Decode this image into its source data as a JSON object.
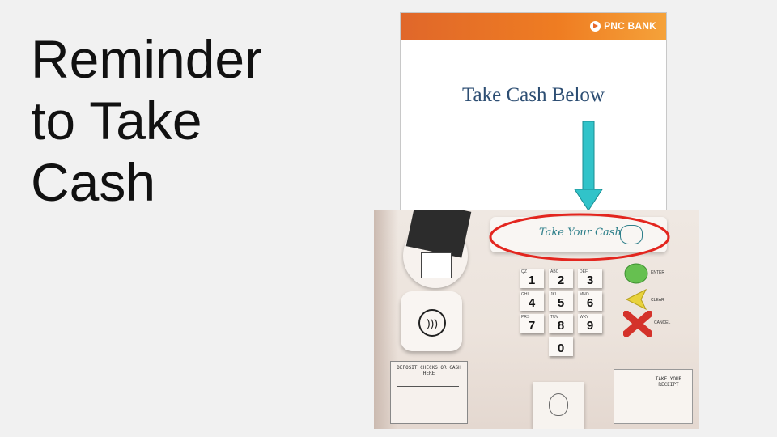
{
  "slide": {
    "title_lines": [
      "Reminder",
      "to Take",
      "Cash"
    ]
  },
  "atm_screen": {
    "bank_name": "PNC BANK",
    "message": "Take Cash Below",
    "header_color": "#e8682a",
    "arrow_color": "#31c3c9"
  },
  "atm_panel": {
    "cash_slot_label": "Take Your Cash",
    "highlight_color": "#e3261f",
    "keypad": [
      {
        "key": "1",
        "sub": "QZ"
      },
      {
        "key": "2",
        "sub": "ABC"
      },
      {
        "key": "3",
        "sub": "DEF"
      },
      {
        "key": "4",
        "sub": "GHI"
      },
      {
        "key": "5",
        "sub": "JKL"
      },
      {
        "key": "6",
        "sub": "MNO"
      },
      {
        "key": "7",
        "sub": "PRS"
      },
      {
        "key": "8",
        "sub": "TUV"
      },
      {
        "key": "9",
        "sub": "WXY"
      },
      {
        "key": "0",
        "sub": ""
      }
    ],
    "function_buttons": {
      "enter": "ENTER",
      "clear": "CLEAR",
      "cancel": "CANCEL"
    },
    "deposit_label": "DEPOSIT CHECKS OR CASH HERE",
    "receipt_label": "TAKE YOUR RECEIPT"
  }
}
